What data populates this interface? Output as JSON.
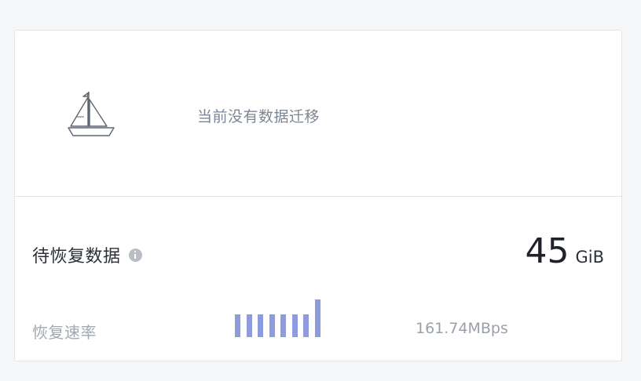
{
  "empty_state": {
    "icon": "sailboat-icon",
    "message": "当前没有数据迁移"
  },
  "recovery": {
    "title": "待恢复数据",
    "info_icon": "info-icon",
    "amount": "45",
    "unit": "GiB"
  },
  "rate": {
    "label": "恢复速率",
    "value": "161.74MBps",
    "bar_levels": [
      0.6,
      0.6,
      0.6,
      0.6,
      0.6,
      0.6,
      0.6,
      1.0
    ],
    "bar_color": "#8e9bdc"
  }
}
